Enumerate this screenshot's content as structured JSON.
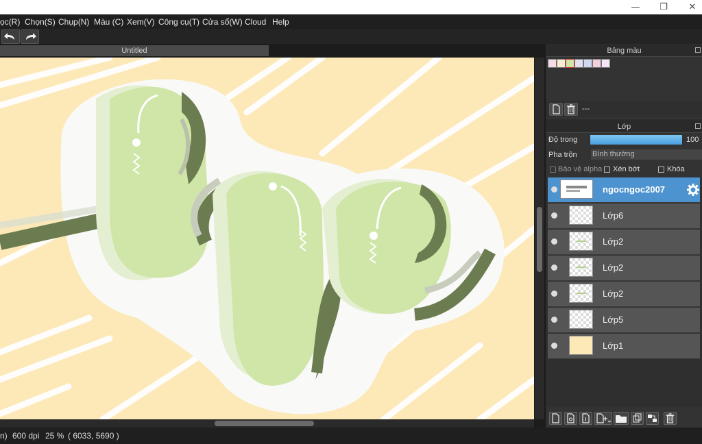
{
  "titlebar": {
    "minimize_icon": "minimize-icon",
    "restore_icon": "restore-icon",
    "close_icon": "close-icon"
  },
  "menu": [
    {
      "label": "ọc(R)"
    },
    {
      "label": "Chọn(S)"
    },
    {
      "label": "Chụp(N)"
    },
    {
      "label": "Màu (C)"
    },
    {
      "label": "Xem(V)"
    },
    {
      "label": "Công cụ(T)"
    },
    {
      "label": "Cửa sổ(W)"
    },
    {
      "label": "Cloud"
    },
    {
      "label": "Help"
    }
  ],
  "toolbar": {
    "undo_icon": "undo-icon",
    "redo_icon": "redo-icon"
  },
  "document": {
    "tab_title": "Untitled"
  },
  "palette_panel": {
    "title": "Bảng màu",
    "swatches": [
      "#f6dde4",
      "#f8edd2",
      "#cfe6a8",
      "#e0e0f0",
      "#cfd8ee",
      "#f4d0dc",
      "#f4e4f4"
    ],
    "palette_name": "---"
  },
  "layer_panel": {
    "title": "Lớp",
    "opacity_label": "Độ trong",
    "opacity_value": "100",
    "blend_label": "Pha trộn",
    "blend_value": "Bình thường",
    "protect_alpha_label": "Bảo vệ alpha",
    "clip_label": "Xén bớt",
    "lock_label": "Khóa",
    "layers": [
      {
        "name": "ngocngoc2007",
        "selected": true
      },
      {
        "name": "Lớp6"
      },
      {
        "name": "Lớp2"
      },
      {
        "name": "Lớp2"
      },
      {
        "name": "Lớp2"
      },
      {
        "name": "Lớp5"
      },
      {
        "name": "Lớp1"
      }
    ]
  },
  "status": {
    "unit": "n)",
    "dpi": "600 dpi",
    "zoom": "25 %",
    "coords": "( 6033, 5690 )"
  },
  "colors": {
    "canvas_bg": "#fce9b7",
    "bean_green": "#cfe6a8",
    "dark_green": "#6b7c50",
    "selected_layer": "#4d93cf"
  }
}
